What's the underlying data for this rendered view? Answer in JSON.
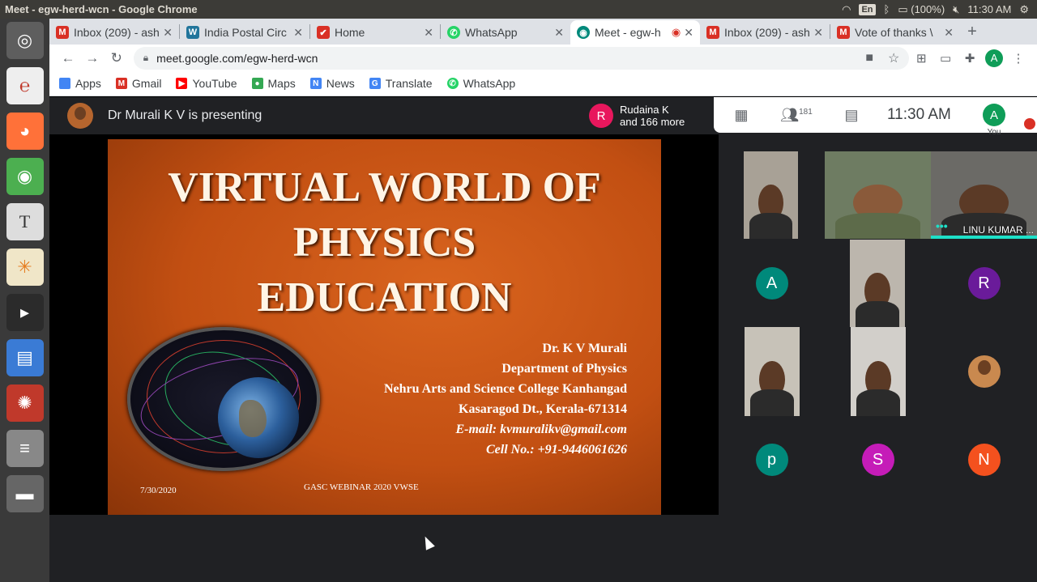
{
  "os": {
    "window_title": "Meet - egw-herd-wcn - Google Chrome",
    "lang": "En",
    "battery": "(100%)",
    "time": "11:30 AM"
  },
  "tabs": [
    {
      "label": "Inbox (209) - ash",
      "fav_color": "#d93025",
      "fav_glyph": "M"
    },
    {
      "label": "India Postal Circ",
      "fav_color": "#21759b",
      "fav_glyph": "W"
    },
    {
      "label": "Home",
      "fav_color": "#d93025",
      "fav_glyph": "✔"
    },
    {
      "label": "WhatsApp",
      "fav_color": "#25d366",
      "fav_glyph": "✆"
    },
    {
      "label": "Meet - egw-h",
      "fav_color": "#00897b",
      "fav_glyph": "◉"
    },
    {
      "label": "Inbox (209) - ash",
      "fav_color": "#d93025",
      "fav_glyph": "M"
    },
    {
      "label": "Vote of thanks \\",
      "fav_color": "#d93025",
      "fav_glyph": "M"
    }
  ],
  "url": "meet.google.com/egw-herd-wcn",
  "bookmarks": [
    {
      "label": "Apps",
      "color": "#4285f4",
      "glyph": "⋮"
    },
    {
      "label": "Gmail",
      "color": "#d93025",
      "glyph": "M"
    },
    {
      "label": "YouTube",
      "color": "#ff0000",
      "glyph": "▶"
    },
    {
      "label": "Maps",
      "color": "#34a853",
      "glyph": "●"
    },
    {
      "label": "News",
      "color": "#4285f4",
      "glyph": "N"
    },
    {
      "label": "Translate",
      "color": "#4285f4",
      "glyph": "G"
    },
    {
      "label": "WhatsApp",
      "color": "#25d366",
      "glyph": "✆"
    }
  ],
  "meet": {
    "presenting_text": "Dr Murali K V is presenting",
    "notice_avatar": "R",
    "notice_line1": "Rudaina K",
    "notice_line2": "and 166 more",
    "participant_count": "181",
    "time": "11:30  AM",
    "you_avatar": "A",
    "you_label": "You"
  },
  "slide": {
    "title_line1": "VIRTUAL WORLD OF",
    "title_line2": "PHYSICS",
    "title_line3": "EDUCATION",
    "author": "Dr. K V Murali",
    "department": "Department of Physics",
    "college": "Nehru Arts and Science College Kanhangad",
    "address": "Kasaragod Dt., Kerala-671314",
    "email": "E-mail: kvmuralikv@gmail.com",
    "cell": "Cell No.: +91-9446061626",
    "date": "7/30/2020",
    "footer": "GASC WEBINAR 2020 VWSE"
  },
  "participants": {
    "linu_name": "LINU KUMAR ...",
    "a_letter": "A",
    "r_letter": "R",
    "p_letter": "p",
    "s_letter": "S",
    "n_letter": "N",
    "colors": {
      "A": "#00897b",
      "R": "#6a1b9a",
      "p": "#00897b",
      "S": "#c51cb8",
      "N": "#f4511e"
    }
  }
}
